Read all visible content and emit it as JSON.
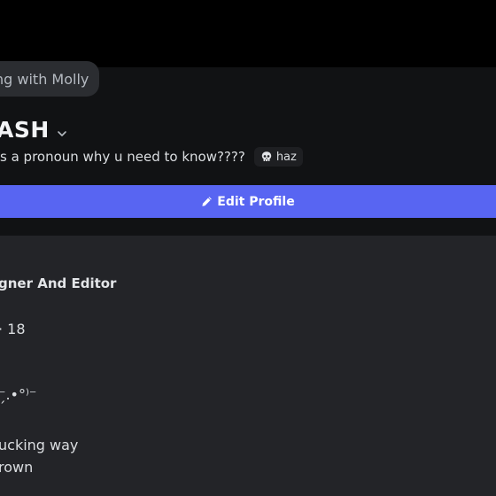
{
  "activity": {
    "text": "ng with Molly"
  },
  "profile": {
    "display_name": "ASH",
    "pronoun_line": "s a pronoun why u need to know????",
    "tag": "haz",
    "edit_button_label": "Edit Profile"
  },
  "bio": {
    "lines": [
      "gner And Editor",
      "· 18",
      "⁻̗.•°⁾⁻",
      "ucking way",
      "rown"
    ]
  },
  "colors": {
    "accent": "#5865f2",
    "card_bg": "#111214",
    "bio_bg": "#232428"
  }
}
